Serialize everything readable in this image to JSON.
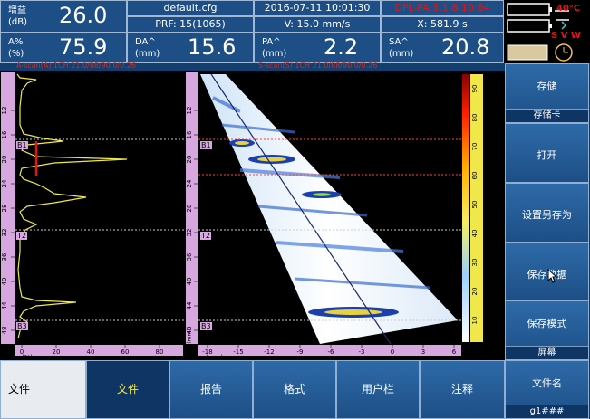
{
  "header": {
    "gain": {
      "label_cn": "增益",
      "label_unit": "(dB)",
      "value": "26.0"
    },
    "amp": {
      "label_cn": "A%",
      "label_unit": "(%)",
      "value": "75.9"
    },
    "file": "default.cfg",
    "prf": "PRF: 15(1065)",
    "datetime": "2016-07-11 10:01:30",
    "velocity": "V: 15.0 mm/s",
    "version": "DPL-PA 3.1.8  10:64",
    "xpos": "X: 581.9  s",
    "da": {
      "label": "DA^",
      "unit": "(mm)",
      "value": "15.6"
    },
    "pa": {
      "label": "PA^",
      "unit": "(mm)",
      "value": "2.2"
    },
    "sa": {
      "label": "SA^",
      "unit": "(mm)",
      "value": "20.8"
    },
    "temperature": "40°C",
    "svw": "S  V  W"
  },
  "status_strip": {
    "left": "A-scan(A) 1CH 21.0/88/90.0/0.26",
    "right": "S-scan(S) 1CH 21.0/88/90.0/0.26"
  },
  "ascan": {
    "depth_ticks": [
      "12",
      "16",
      "20",
      "24",
      "28",
      "32",
      "36",
      "40",
      "44",
      "48",
      "52"
    ],
    "amp_ticks": [
      "0",
      "20",
      "40",
      "60",
      "80"
    ],
    "amp_unit": "(%)",
    "gates": [
      "B1",
      "T2",
      "B3"
    ]
  },
  "sscan": {
    "depth_ticks": [
      "12",
      "16",
      "20",
      "24",
      "28",
      "32",
      "36",
      "40",
      "44",
      "48"
    ],
    "x_ticks": [
      "-18",
      "-15",
      "-12",
      "-9",
      "-6",
      "-3",
      "0",
      "3",
      "6"
    ],
    "x_unit": "(mm)",
    "depth_unit": "(mm)",
    "gates": [
      "B1",
      "T2",
      "B3"
    ],
    "colorbar_ticks": [
      "90",
      "80",
      "70",
      "60",
      "50",
      "40",
      "30",
      "20",
      "10"
    ]
  },
  "right_panel": {
    "store": {
      "label": "存储",
      "sub": "存储卡"
    },
    "open": {
      "label": "打开"
    },
    "save_as": {
      "label": "设置另存为"
    },
    "save_data": {
      "label": "保存数据"
    },
    "save_mode": {
      "label": "保存模式",
      "sub": "屏幕"
    },
    "filename": {
      "label": "文件名",
      "sub": "g1###"
    }
  },
  "bottom_tabs": {
    "home": "文件",
    "file": "文件",
    "report": "报告",
    "format": "格式",
    "user": "用户栏",
    "note": "注释"
  },
  "colors": {
    "accent": "#1d4f86",
    "yellow": "#f0e84a",
    "red": "#e01515",
    "panel": "#0e3563"
  }
}
